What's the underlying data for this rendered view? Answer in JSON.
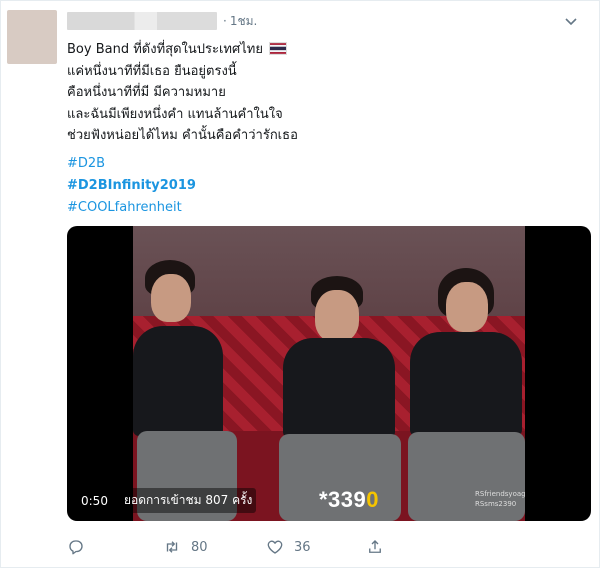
{
  "tweet": {
    "time_separator": "·",
    "time": "1ชม.",
    "text_lines": [
      "Boy Band ที่ดังที่สุดในประเทศไทย",
      "แค่หนึ่งนาทีที่มีเธอ ยืนอยู่ตรงนี้",
      "คือหนึ่งนาทีที่มี มีความหมาย",
      "และฉันมีเพียงหนึ่งคำ แทนล้านคำในใจ",
      "ช่วยฟังหน่อยได้ไหม คำนั้นคือคำว่ารักเธอ"
    ],
    "hashtags": [
      "#D2B",
      "#D2BInfinity2019",
      "#COOLfahrenheit"
    ],
    "flag_colors": [
      "#a51931",
      "#f4f5f8",
      "#2d2a4a"
    ],
    "flag_icon": "thailand-flag-icon"
  },
  "video": {
    "duration": "0:50",
    "views_label": "ยอดการเข้าชม 807 ครั้ง",
    "overlay_number_prefix": "*339",
    "overlay_number_suffix": "0",
    "overlay_small_lines": [
      "RSfriendsyoage",
      "RSsms2390"
    ],
    "logo_text": "RS"
  },
  "actions": {
    "reply_count": "",
    "retweet_count": "80",
    "like_count": "36",
    "icons": [
      "reply-icon",
      "retweet-icon",
      "like-icon",
      "share-icon"
    ]
  },
  "colors": {
    "link": "#1b95e0",
    "muted": "#657786",
    "text": "#14171a"
  }
}
